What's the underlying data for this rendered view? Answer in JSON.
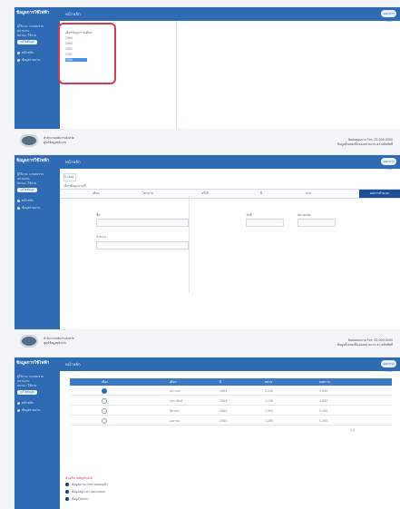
{
  "panels": {
    "p1": {
      "brand": "ข้อมูลการใช้ไฟฟ้า",
      "crumb": "หน้าหลัก",
      "pill": "ออกจากระบบ",
      "user_lines": [
        "ผู้ใช้งาน: นายสมชาย",
        "หน่วยงาน",
        "สถานะ: ใช้งาน"
      ],
      "side_button": "แก้ไขข้อมูล",
      "nav": [
        "หน้าหลัก",
        "ข้อมูลรายงาน"
      ],
      "dropdown": {
        "title": "เลือกข้อมูลรายเดือน",
        "options": [
          "2564",
          "2563",
          "2562",
          "2561",
          "2560"
        ],
        "selected_index": 4
      },
      "footer": {
        "left_line1": "สำนักงานพลังงานจังหวัด",
        "left_line2": "ศูนย์ข้อมูลพลังงาน",
        "right_line1": "ติดต่อสอบถาม โทร. 02-000-0000",
        "right_line2": "ข้อมูลทั้งหมดเป็นของหน่วยงาน สงวนลิขสิทธิ์"
      }
    },
    "p2": {
      "brand": "ข้อมูลการใช้ไฟฟ้า",
      "crumb": "หน้าหลัก",
      "pill": "ออกจากระบบ",
      "user_lines": [
        "ผู้ใช้งาน: นายสมชาย",
        "หน่วยงาน",
        "สถานะ: ใช้งาน"
      ],
      "side_button": "แก้ไขข้อมูล",
      "nav": [
        "หน้าหลัก",
        "ข้อมูลรายงาน"
      ],
      "select_value": "ปี 2564",
      "select_label": "เลือกข้อมูลรายปี",
      "tabs": [
        "เดือน",
        "ไตรมาส",
        "ครึ่งปี",
        "ปี",
        "สรุป"
      ],
      "tab_active": "ผลการคำนวณ",
      "fields": {
        "a_label": "ชื่อ",
        "b_label": "วันที่",
        "c_label": "จำนวน",
        "d_label": "หมายเหตุ"
      },
      "footer": {
        "left_line1": "สำนักงานพลังงานจังหวัด",
        "left_line2": "ศูนย์ข้อมูลพลังงาน",
        "right_line1": "ติดต่อสอบถาม โทร. 02-000-0000",
        "right_line2": "ข้อมูลทั้งหมดเป็นของหน่วยงาน สงวนลิขสิทธิ์"
      }
    },
    "p3": {
      "brand": "ข้อมูลการใช้ไฟฟ้า",
      "crumb": "หน้าหลัก",
      "pill": "ออกจากระบบ",
      "user_lines": [
        "ผู้ใช้งาน: นายสมชาย",
        "หน่วยงาน",
        "สถานะ: ใช้งาน"
      ],
      "side_button": "แก้ไขข้อมูล",
      "nav": [
        "หน้าหลัก",
        "ข้อมูลรายงาน"
      ],
      "table": {
        "headers": [
          "เลือก",
          "เดือน",
          "ปี",
          "หน่วย",
          "ยอดรวม"
        ],
        "rows": [
          [
            "",
            "มกราคม",
            "2564",
            "1,200",
            "5,000"
          ],
          [
            "",
            "กุมภาพันธ์",
            "2564",
            "1,150",
            "4,800"
          ],
          [
            "",
            "มีนาคม",
            "2564",
            "1,300",
            "5,400"
          ],
          [
            "",
            "เมษายน",
            "2564",
            "1,280",
            "5,300"
          ]
        ],
        "selected_row": 0,
        "pager": "1-4"
      },
      "legend": {
        "title": "คำอธิบายสัญลักษณ์",
        "items": [
          "ข้อมูลผ่านการตรวจสอบแล้ว",
          "ข้อมูลอยู่ระหว่างตรวจสอบ",
          "ข้อมูลไม่ครบ"
        ]
      }
    }
  }
}
